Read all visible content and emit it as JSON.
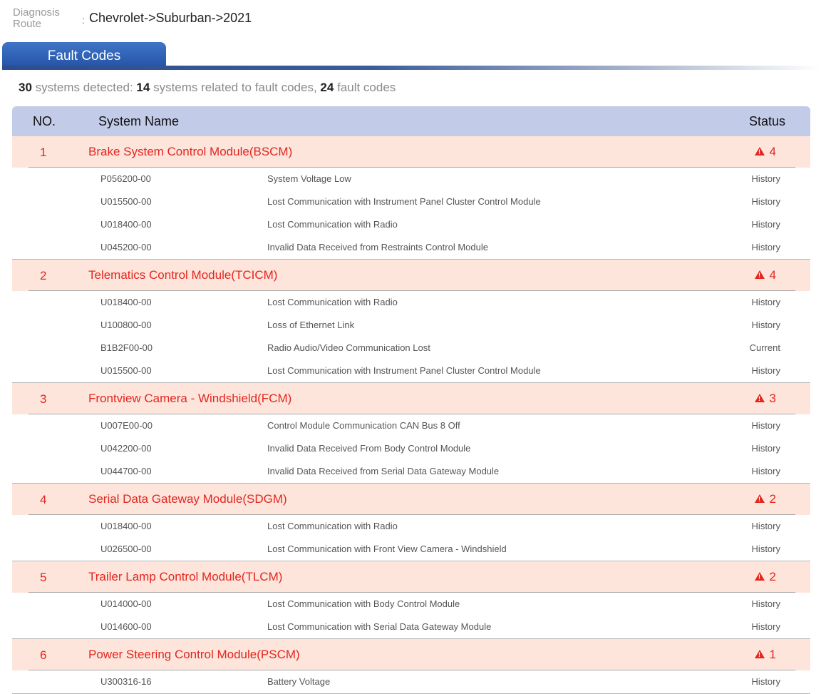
{
  "route": {
    "label": "Diagnosis Route",
    "colon": ":",
    "value": "Chevrolet->Suburban->2021"
  },
  "tab": {
    "label": "Fault Codes"
  },
  "summary": {
    "systems_detected": "30",
    "systems_detected_text": "systems detected:",
    "systems_related": "14",
    "systems_related_text": "systems related to fault codes,",
    "fault_codes": "24",
    "fault_codes_text": "fault codes"
  },
  "table": {
    "headers": {
      "no": "NO.",
      "name": "System Name",
      "status": "Status"
    },
    "warn_color": "#e3261f",
    "systems": [
      {
        "no": "1",
        "name": "Brake System Control Module(BSCM)",
        "count": "4",
        "faults": [
          {
            "code": "P056200-00",
            "desc": "System Voltage Low",
            "status": "History"
          },
          {
            "code": "U015500-00",
            "desc": "Lost Communication with Instrument Panel Cluster Control Module",
            "status": "History"
          },
          {
            "code": "U018400-00",
            "desc": "Lost Communication with Radio",
            "status": "History"
          },
          {
            "code": "U045200-00",
            "desc": "Invalid Data Received from Restraints Control Module",
            "status": "History"
          }
        ]
      },
      {
        "no": "2",
        "name": "Telematics Control Module(TCICM)",
        "count": "4",
        "faults": [
          {
            "code": "U018400-00",
            "desc": "Lost Communication with Radio",
            "status": "History"
          },
          {
            "code": "U100800-00",
            "desc": "Loss of Ethernet Link",
            "status": "History"
          },
          {
            "code": "B1B2F00-00",
            "desc": "Radio Audio/Video Communication Lost",
            "status": "Current"
          },
          {
            "code": "U015500-00",
            "desc": "Lost Communication with Instrument Panel Cluster Control Module",
            "status": "History"
          }
        ]
      },
      {
        "no": "3",
        "name": "Frontview Camera - Windshield(FCM)",
        "count": "3",
        "faults": [
          {
            "code": "U007E00-00",
            "desc": "Control Module Communication CAN Bus 8 Off",
            "status": "History"
          },
          {
            "code": "U042200-00",
            "desc": "Invalid Data Received From Body Control Module",
            "status": "History"
          },
          {
            "code": "U044700-00",
            "desc": "Invalid Data Received from Serial Data Gateway Module",
            "status": "History"
          }
        ]
      },
      {
        "no": "4",
        "name": "Serial Data Gateway Module(SDGM)",
        "count": "2",
        "faults": [
          {
            "code": "U018400-00",
            "desc": "Lost Communication with Radio",
            "status": "History"
          },
          {
            "code": "U026500-00",
            "desc": "Lost Communication with Front View Camera - Windshield",
            "status": "History"
          }
        ]
      },
      {
        "no": "5",
        "name": "Trailer Lamp Control Module(TLCM)",
        "count": "2",
        "faults": [
          {
            "code": "U014000-00",
            "desc": "Lost Communication with Body Control Module",
            "status": "History"
          },
          {
            "code": "U014600-00",
            "desc": "Lost Communication with Serial Data Gateway Module",
            "status": "History"
          }
        ]
      },
      {
        "no": "6",
        "name": "Power Steering Control Module(PSCM)",
        "count": "1",
        "faults": [
          {
            "code": "U300316-16",
            "desc": "Battery Voltage",
            "status": "History"
          }
        ]
      }
    ]
  }
}
